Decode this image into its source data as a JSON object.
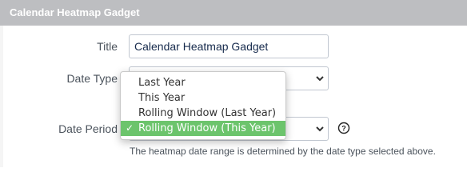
{
  "panel": {
    "title": "Calendar Heatmap Gadget"
  },
  "form": {
    "title_label": "Title",
    "title_value": "Calendar Heatmap Gadget",
    "date_type_label": "Date Type",
    "date_period_label": "Date Period",
    "description": "The heatmap date range is determined by the date type selected above."
  },
  "dropdown": {
    "options": [
      {
        "label": "Last Year",
        "selected": false
      },
      {
        "label": "This Year",
        "selected": false
      },
      {
        "label": "Rolling Window (Last Year)",
        "selected": false
      },
      {
        "label": "Rolling Window (This Year)",
        "selected": true
      }
    ],
    "check_glyph": "✓"
  },
  "icons": {
    "select_chevron": "chevron-down-icon",
    "help": "question-circle-icon",
    "check": "check-icon"
  },
  "colors": {
    "header_bg": "#bdbec1",
    "selected_bg": "#6cc46c"
  }
}
